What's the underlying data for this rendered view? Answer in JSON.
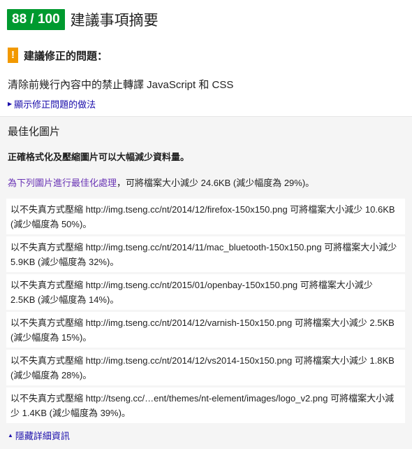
{
  "header": {
    "score": "88 / 100",
    "title": "建議事項摘要",
    "score_color": "#009a2f"
  },
  "warning": {
    "icon_glyph": "!",
    "label": "建議修正的問題：",
    "color": "#f29900"
  },
  "rule": {
    "title": "清除前幾行內容中的禁止轉譯 JavaScript 和 CSS",
    "show_link": "顯示修正問題的做法"
  },
  "optimize": {
    "title": "最佳化圖片",
    "description": "正確格式化及壓縮圖片可以大幅減少資料量。",
    "summary_link": "為下列圖片進行最佳化處理",
    "summary_text": "，可將檔案大小減少 24.6KB (減少幅度為 29%)。",
    "items": [
      "以不失真方式壓縮 http://img.tseng.cc/nt/2014/12/firefox-150x150.png 可將檔案大小減少 10.6KB (減少幅度為 50%)。",
      "以不失真方式壓縮 http://img.tseng.cc/nt/2014/11/mac_bluetooth-150x150.png 可將檔案大小減少 5.9KB (減少幅度為 32%)。",
      "以不失真方式壓縮 http://img.tseng.cc/nt/2015/01/openbay-150x150.png 可將檔案大小減少 2.5KB (減少幅度為 14%)。",
      "以不失真方式壓縮 http://img.tseng.cc/nt/2014/12/varnish-150x150.png 可將檔案大小減少 2.5KB (減少幅度為 15%)。",
      "以不失真方式壓縮 http://img.tseng.cc/nt/2014/12/vs2014-150x150.png 可將檔案大小減少 1.8KB (減少幅度為 28%)。",
      "以不失真方式壓縮 http://tseng.cc/…ent/themes/nt-element/images/logo_v2.png 可將檔案大小減少 1.4KB (減少幅度為 39%)。"
    ],
    "hide_link": "隱藏詳細資訊"
  },
  "icons": {
    "show_toggle": "triangle-right-icon",
    "hide_toggle": "triangle-up-icon",
    "warning": "exclamation-icon"
  }
}
